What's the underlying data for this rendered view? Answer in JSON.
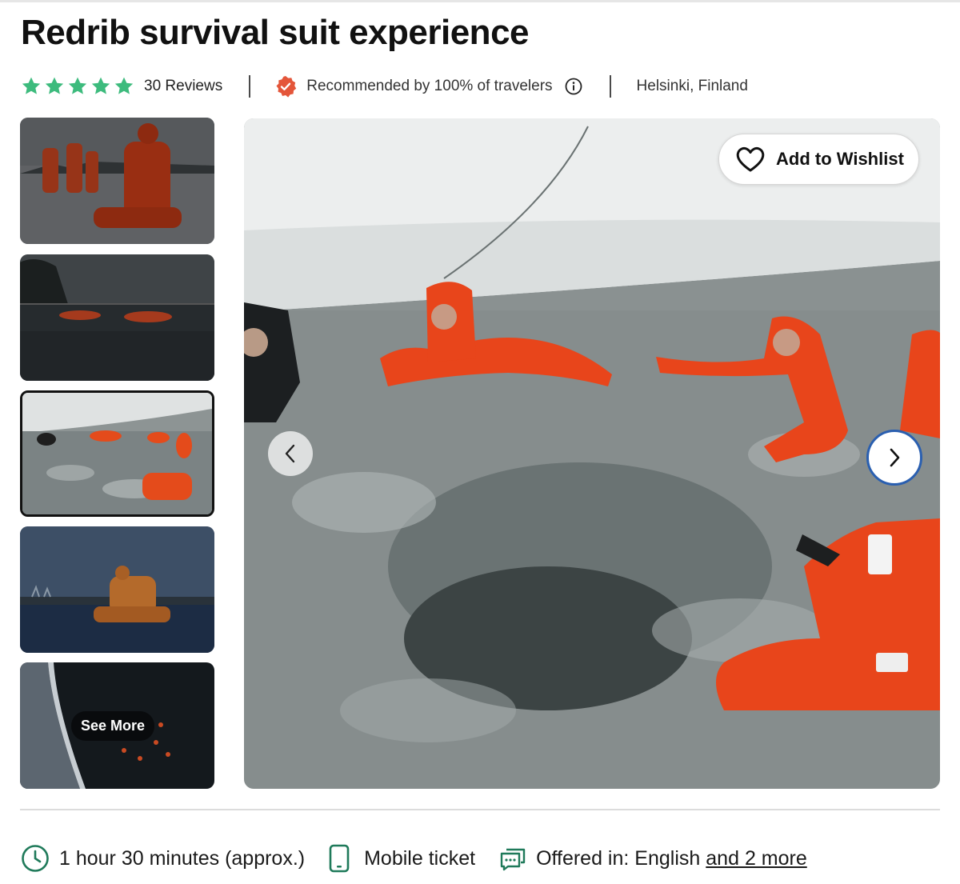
{
  "title": "Redrib survival suit experience",
  "rating": {
    "stars": 5,
    "reviews_label": "30 Reviews",
    "star_color": "#3dbb7d"
  },
  "recommendation": {
    "text": "Recommended by 100% of travelers",
    "badge_color": "#e4563a"
  },
  "location": "Helsinki, Finland",
  "gallery": {
    "thumbnails": [
      {
        "alt": "Group in orange survival suits on ice"
      },
      {
        "alt": "People floating in suits at dusk"
      },
      {
        "alt": "Swimmers in icy water",
        "selected": true
      },
      {
        "alt": "Person in suit kneeling in sea"
      },
      {
        "alt": "Aerial view of ice edge",
        "overlay_label": "See More"
      }
    ],
    "selected_index": 3,
    "wishlist_label": "Add to Wishlist",
    "prev_icon": "chevron-left-icon",
    "next_icon": "chevron-right-icon"
  },
  "features": {
    "duration": "1 hour 30 minutes (approx.)",
    "ticket": "Mobile ticket",
    "language_prefix": "Offered in: English",
    "language_more": "and 2 more",
    "icon_color": "#1f7a5a"
  }
}
